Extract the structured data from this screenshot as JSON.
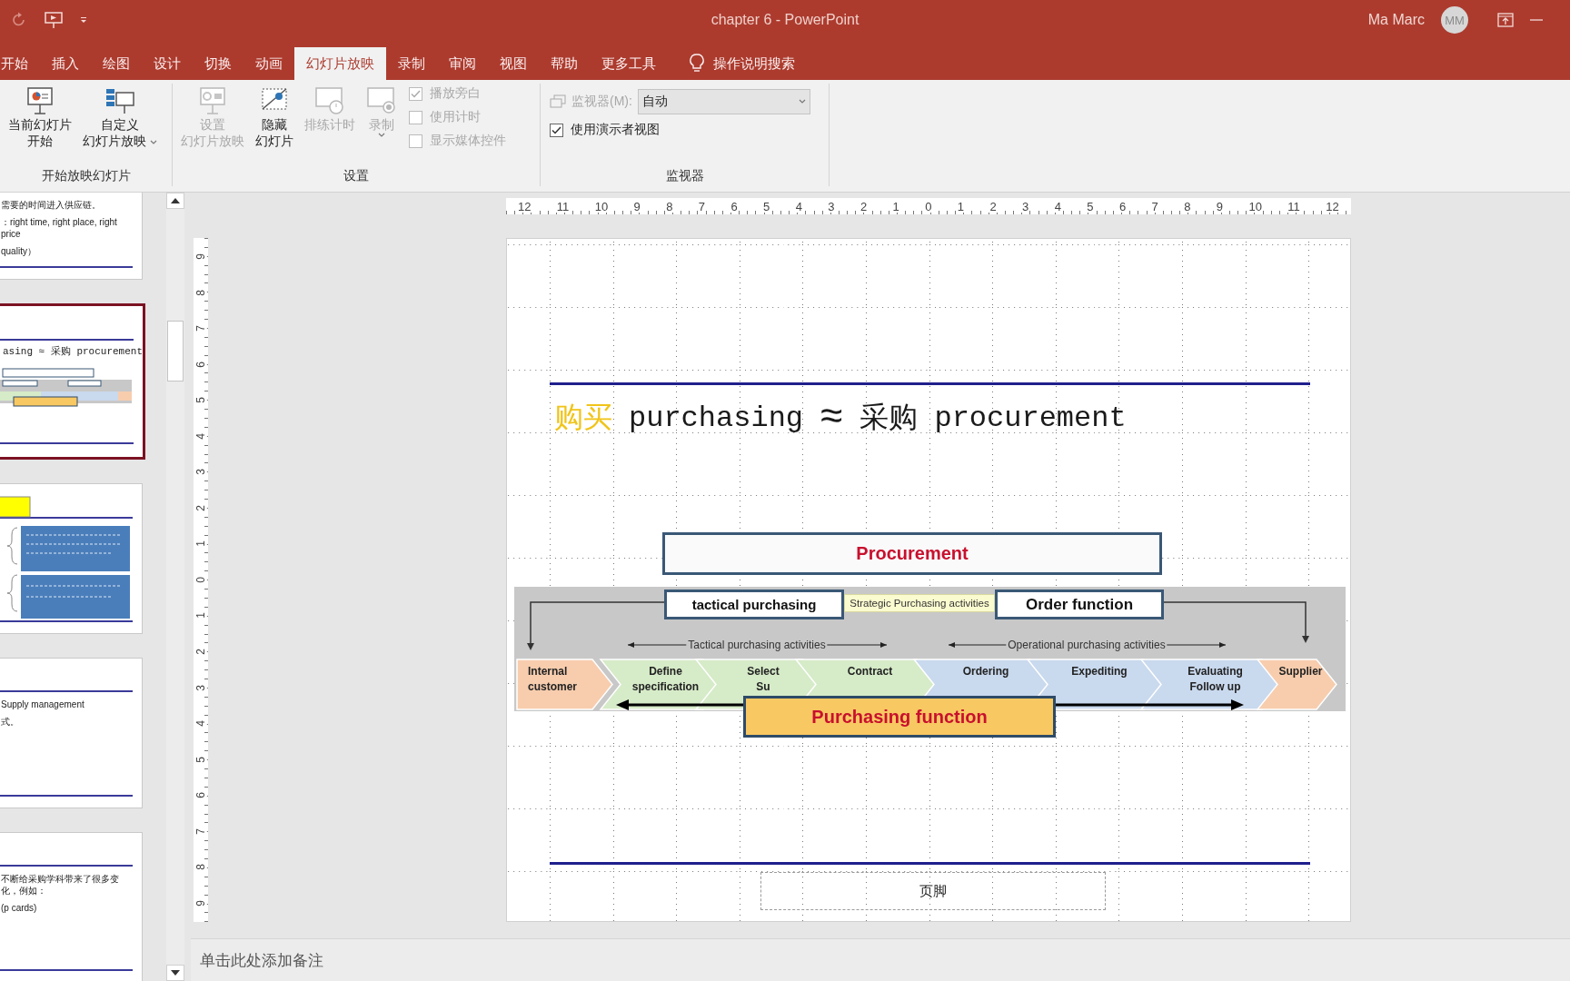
{
  "window": {
    "title": "chapter 6  -  PowerPoint",
    "user": "Ma Marc",
    "avatar": "MM"
  },
  "ribbon_tabs": [
    {
      "label": "开始",
      "selected": false
    },
    {
      "label": "插入",
      "selected": false
    },
    {
      "label": "绘图",
      "selected": false
    },
    {
      "label": "设计",
      "selected": false
    },
    {
      "label": "切换",
      "selected": false
    },
    {
      "label": "动画",
      "selected": false
    },
    {
      "label": "幻灯片放映",
      "selected": true
    },
    {
      "label": "录制",
      "selected": false
    },
    {
      "label": "审阅",
      "selected": false
    },
    {
      "label": "视图",
      "selected": false
    },
    {
      "label": "帮助",
      "selected": false
    },
    {
      "label": "更多工具",
      "selected": false
    }
  ],
  "tell_me": "操作说明搜索",
  "ribbon_groups": [
    {
      "label": "开始放映幻灯片",
      "items": [
        {
          "kind": "big",
          "lines": [
            "当前幻灯片",
            "开始"
          ],
          "disabled": false
        },
        {
          "kind": "big",
          "lines": [
            "自定义",
            "幻灯片放映"
          ],
          "dropdown": true,
          "disabled": false
        }
      ]
    },
    {
      "label": "设置",
      "items": [
        {
          "kind": "big",
          "lines": [
            "设置",
            "幻灯片放映"
          ],
          "disabled": true
        },
        {
          "kind": "big",
          "lines": [
            "隐藏",
            "幻灯片"
          ],
          "disabled": false
        },
        {
          "kind": "big",
          "lines": [
            "排练计时"
          ],
          "disabled": true
        },
        {
          "kind": "big",
          "lines": [
            "录制"
          ],
          "dropdown": true,
          "disabled": true
        },
        {
          "kind": "stack",
          "rows": [
            {
              "kind": "check",
              "label": "播放旁白",
              "checked": true,
              "disabled": true
            },
            {
              "kind": "check",
              "label": "使用计时",
              "checked": false,
              "disabled": true
            },
            {
              "kind": "check",
              "label": "显示媒体控件",
              "checked": false,
              "disabled": true
            }
          ]
        }
      ]
    },
    {
      "label": "监视器",
      "items": [
        {
          "kind": "stack",
          "rows": [
            {
              "kind": "select",
              "label": "监视器(M):",
              "value": "自动",
              "disabled": true
            },
            {
              "kind": "check",
              "label": "使用演示者视图",
              "checked": true,
              "disabled": false
            }
          ]
        }
      ]
    }
  ],
  "thumbnails": [
    {
      "kind": "tail",
      "selected": false,
      "lines": [
        "需要的时间进入供应链。",
        "：right time, right place, right price",
        "quality）"
      ]
    },
    {
      "kind": "diagram",
      "selected": true,
      "lines": [
        "asing  ≈  采购 procurement"
      ]
    },
    {
      "kind": "boxes",
      "selected": false
    },
    {
      "kind": "text",
      "selected": false,
      "lines": [
        "Supply management",
        "式。"
      ]
    },
    {
      "kind": "text",
      "selected": false,
      "lines": [
        "不断给采购学科带来了很多变化，例如：",
        "(p cards)"
      ]
    }
  ],
  "ruler": {
    "horizontal": [
      "12",
      "11",
      "10",
      "9",
      "8",
      "7",
      "6",
      "5",
      "4",
      "3",
      "2",
      "1",
      "0",
      "1",
      "2",
      "3",
      "4",
      "5",
      "6",
      "7",
      "8",
      "9",
      "10",
      "11",
      "12"
    ],
    "vertical": [
      "9",
      "8",
      "7",
      "6",
      "5",
      "4",
      "3",
      "2",
      "1",
      "0",
      "1",
      "2",
      "3",
      "4",
      "5",
      "6",
      "7",
      "8",
      "9"
    ]
  },
  "slide": {
    "title": [
      {
        "text": "购买",
        "highlight": true
      },
      {
        "text": "purchasing",
        "highlight": false
      },
      {
        "text": "≈",
        "highlight": false
      },
      {
        "text": "采购",
        "highlight": false
      },
      {
        "text": "procurement",
        "highlight": false
      }
    ],
    "diagram": {
      "procurement": "Procurement",
      "tactical": "tactical purchasing",
      "strategic": "Strategic Purchasing activities",
      "order": "Order function",
      "ranges": [
        "Tactical purchasing activities",
        "Operational purchasing activities"
      ],
      "steps": [
        {
          "lines": [
            "Internal",
            "customer"
          ],
          "color": "#f7cdae"
        },
        {
          "lines": [
            "Define",
            "specification"
          ],
          "color": "#d6ebc8"
        },
        {
          "lines": [
            "Select",
            "Su"
          ],
          "color": "#d6ebc8"
        },
        {
          "lines": [
            "Contract"
          ],
          "color": "#d6ebc8"
        },
        {
          "lines": [
            "Ordering"
          ],
          "color": "#c9d9ee"
        },
        {
          "lines": [
            "Expediting"
          ],
          "color": "#c9d9ee"
        },
        {
          "lines": [
            "Evaluating",
            "Follow up"
          ],
          "color": "#c9d9ee"
        },
        {
          "lines": [
            "Supplier"
          ],
          "color": "#f7cdae"
        }
      ],
      "purchasing": "Purchasing function"
    },
    "footer": "页脚"
  },
  "notes": {
    "placeholder": "单击此处添加备注"
  }
}
